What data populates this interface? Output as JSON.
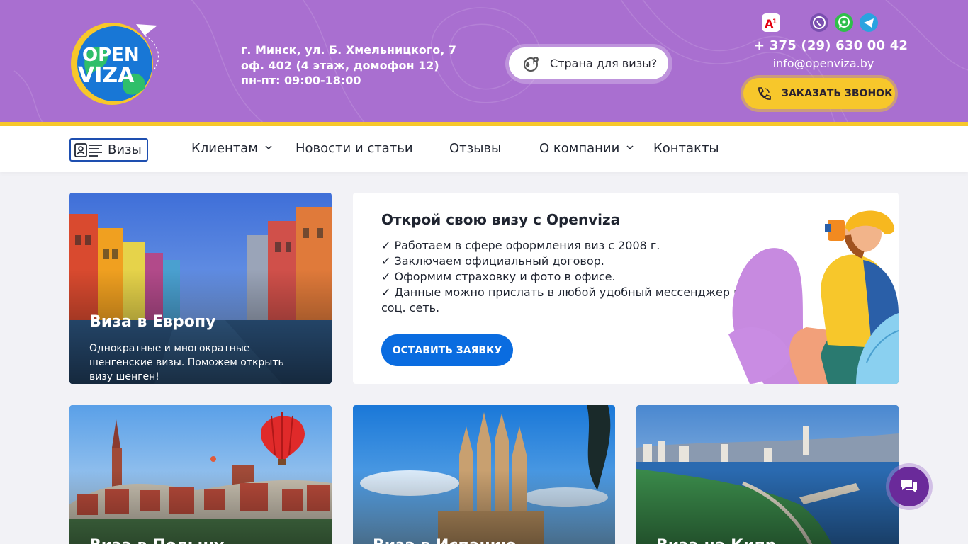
{
  "header": {
    "logo_text_top": "OPEN",
    "logo_text_bottom": "VIZA",
    "address_line1": "г. Минск, ул. Б. Хмельницкого, 7",
    "address_line2": "оф. 402 (4 этаж, домофон 12)",
    "hours": "пн-пт: 09:00-18:00",
    "country_button_label": "Страна для визы?",
    "phone": "+ 375 (29) 630 00 42",
    "email": "info@openviza.by",
    "call_button_label": "ЗАКАЗАТЬ ЗВОНОК",
    "messengers": [
      "a1-icon",
      "viber-icon",
      "whatsapp-icon",
      "telegram-icon"
    ],
    "colors": {
      "header_bg": "#a96fd0",
      "accent_yellow": "#f7c72b"
    }
  },
  "nav": {
    "visas_label": "Визы",
    "items": [
      {
        "label": "Клиентам",
        "has_dropdown": true
      },
      {
        "label": "Новости и статьи",
        "has_dropdown": false
      },
      {
        "label": "Отзывы",
        "has_dropdown": false
      },
      {
        "label": "О компании",
        "has_dropdown": true
      },
      {
        "label": "Контакты",
        "has_dropdown": false
      }
    ]
  },
  "featured_card": {
    "title": "Виза в Европу",
    "description": "Однократные и многократные шенгенские визы. Поможем открыть визу шенген!"
  },
  "promo": {
    "title": "Открой свою визу с Openviza",
    "bullets": [
      "✓ Работаем в сфере оформления виз с 2008 г.",
      "✓ Заключаем официальный договор.",
      "✓ Оформим страховку и фото в офисе.",
      "✓ Данные можно прислать в любой удобный мессенджер или соц. сеть."
    ],
    "button_label": "ОСТАВИТЬ ЗАЯВКУ",
    "button_color": "#0a6ce0"
  },
  "cards": [
    {
      "title": "Виза в Польшу"
    },
    {
      "title": "Виза в Испанию"
    },
    {
      "title": "Виза на Кипр"
    }
  ],
  "chat": {
    "icon": "chat-bubbles-icon"
  }
}
